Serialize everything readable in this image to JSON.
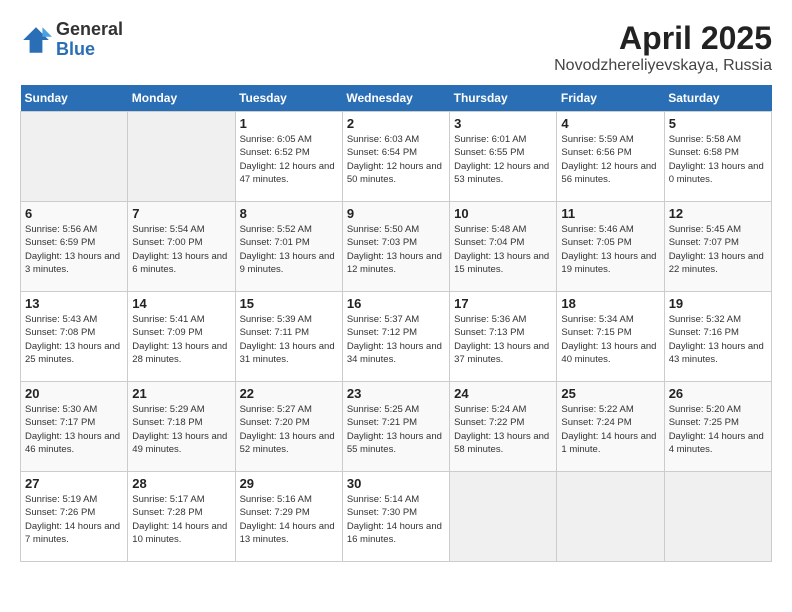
{
  "header": {
    "logo_general": "General",
    "logo_blue": "Blue",
    "month_year": "April 2025",
    "location": "Novodzhereliyevskaya, Russia"
  },
  "weekdays": [
    "Sunday",
    "Monday",
    "Tuesday",
    "Wednesday",
    "Thursday",
    "Friday",
    "Saturday"
  ],
  "weeks": [
    [
      {
        "day": "",
        "empty": true
      },
      {
        "day": "",
        "empty": true
      },
      {
        "day": "1",
        "sunrise": "Sunrise: 6:05 AM",
        "sunset": "Sunset: 6:52 PM",
        "daylight": "Daylight: 12 hours and 47 minutes."
      },
      {
        "day": "2",
        "sunrise": "Sunrise: 6:03 AM",
        "sunset": "Sunset: 6:54 PM",
        "daylight": "Daylight: 12 hours and 50 minutes."
      },
      {
        "day": "3",
        "sunrise": "Sunrise: 6:01 AM",
        "sunset": "Sunset: 6:55 PM",
        "daylight": "Daylight: 12 hours and 53 minutes."
      },
      {
        "day": "4",
        "sunrise": "Sunrise: 5:59 AM",
        "sunset": "Sunset: 6:56 PM",
        "daylight": "Daylight: 12 hours and 56 minutes."
      },
      {
        "day": "5",
        "sunrise": "Sunrise: 5:58 AM",
        "sunset": "Sunset: 6:58 PM",
        "daylight": "Daylight: 13 hours and 0 minutes."
      }
    ],
    [
      {
        "day": "6",
        "sunrise": "Sunrise: 5:56 AM",
        "sunset": "Sunset: 6:59 PM",
        "daylight": "Daylight: 13 hours and 3 minutes."
      },
      {
        "day": "7",
        "sunrise": "Sunrise: 5:54 AM",
        "sunset": "Sunset: 7:00 PM",
        "daylight": "Daylight: 13 hours and 6 minutes."
      },
      {
        "day": "8",
        "sunrise": "Sunrise: 5:52 AM",
        "sunset": "Sunset: 7:01 PM",
        "daylight": "Daylight: 13 hours and 9 minutes."
      },
      {
        "day": "9",
        "sunrise": "Sunrise: 5:50 AM",
        "sunset": "Sunset: 7:03 PM",
        "daylight": "Daylight: 13 hours and 12 minutes."
      },
      {
        "day": "10",
        "sunrise": "Sunrise: 5:48 AM",
        "sunset": "Sunset: 7:04 PM",
        "daylight": "Daylight: 13 hours and 15 minutes."
      },
      {
        "day": "11",
        "sunrise": "Sunrise: 5:46 AM",
        "sunset": "Sunset: 7:05 PM",
        "daylight": "Daylight: 13 hours and 19 minutes."
      },
      {
        "day": "12",
        "sunrise": "Sunrise: 5:45 AM",
        "sunset": "Sunset: 7:07 PM",
        "daylight": "Daylight: 13 hours and 22 minutes."
      }
    ],
    [
      {
        "day": "13",
        "sunrise": "Sunrise: 5:43 AM",
        "sunset": "Sunset: 7:08 PM",
        "daylight": "Daylight: 13 hours and 25 minutes."
      },
      {
        "day": "14",
        "sunrise": "Sunrise: 5:41 AM",
        "sunset": "Sunset: 7:09 PM",
        "daylight": "Daylight: 13 hours and 28 minutes."
      },
      {
        "day": "15",
        "sunrise": "Sunrise: 5:39 AM",
        "sunset": "Sunset: 7:11 PM",
        "daylight": "Daylight: 13 hours and 31 minutes."
      },
      {
        "day": "16",
        "sunrise": "Sunrise: 5:37 AM",
        "sunset": "Sunset: 7:12 PM",
        "daylight": "Daylight: 13 hours and 34 minutes."
      },
      {
        "day": "17",
        "sunrise": "Sunrise: 5:36 AM",
        "sunset": "Sunset: 7:13 PM",
        "daylight": "Daylight: 13 hours and 37 minutes."
      },
      {
        "day": "18",
        "sunrise": "Sunrise: 5:34 AM",
        "sunset": "Sunset: 7:15 PM",
        "daylight": "Daylight: 13 hours and 40 minutes."
      },
      {
        "day": "19",
        "sunrise": "Sunrise: 5:32 AM",
        "sunset": "Sunset: 7:16 PM",
        "daylight": "Daylight: 13 hours and 43 minutes."
      }
    ],
    [
      {
        "day": "20",
        "sunrise": "Sunrise: 5:30 AM",
        "sunset": "Sunset: 7:17 PM",
        "daylight": "Daylight: 13 hours and 46 minutes."
      },
      {
        "day": "21",
        "sunrise": "Sunrise: 5:29 AM",
        "sunset": "Sunset: 7:18 PM",
        "daylight": "Daylight: 13 hours and 49 minutes."
      },
      {
        "day": "22",
        "sunrise": "Sunrise: 5:27 AM",
        "sunset": "Sunset: 7:20 PM",
        "daylight": "Daylight: 13 hours and 52 minutes."
      },
      {
        "day": "23",
        "sunrise": "Sunrise: 5:25 AM",
        "sunset": "Sunset: 7:21 PM",
        "daylight": "Daylight: 13 hours and 55 minutes."
      },
      {
        "day": "24",
        "sunrise": "Sunrise: 5:24 AM",
        "sunset": "Sunset: 7:22 PM",
        "daylight": "Daylight: 13 hours and 58 minutes."
      },
      {
        "day": "25",
        "sunrise": "Sunrise: 5:22 AM",
        "sunset": "Sunset: 7:24 PM",
        "daylight": "Daylight: 14 hours and 1 minute."
      },
      {
        "day": "26",
        "sunrise": "Sunrise: 5:20 AM",
        "sunset": "Sunset: 7:25 PM",
        "daylight": "Daylight: 14 hours and 4 minutes."
      }
    ],
    [
      {
        "day": "27",
        "sunrise": "Sunrise: 5:19 AM",
        "sunset": "Sunset: 7:26 PM",
        "daylight": "Daylight: 14 hours and 7 minutes."
      },
      {
        "day": "28",
        "sunrise": "Sunrise: 5:17 AM",
        "sunset": "Sunset: 7:28 PM",
        "daylight": "Daylight: 14 hours and 10 minutes."
      },
      {
        "day": "29",
        "sunrise": "Sunrise: 5:16 AM",
        "sunset": "Sunset: 7:29 PM",
        "daylight": "Daylight: 14 hours and 13 minutes."
      },
      {
        "day": "30",
        "sunrise": "Sunrise: 5:14 AM",
        "sunset": "Sunset: 7:30 PM",
        "daylight": "Daylight: 14 hours and 16 minutes."
      },
      {
        "day": "",
        "empty": true
      },
      {
        "day": "",
        "empty": true
      },
      {
        "day": "",
        "empty": true
      }
    ]
  ]
}
